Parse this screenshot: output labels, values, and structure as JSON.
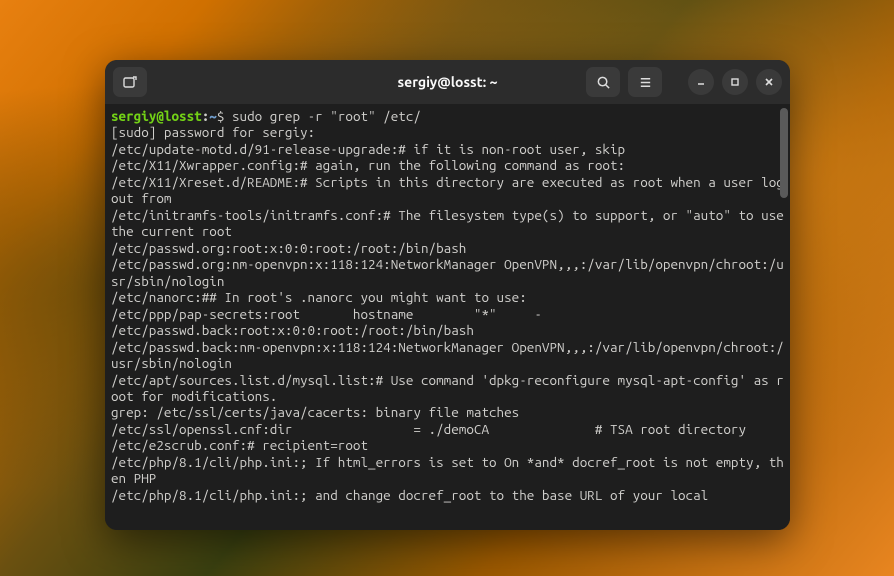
{
  "titlebar": {
    "title": "sergiy@losst: ~"
  },
  "prompt": {
    "user_host": "sergiy@losst",
    "colon": ":",
    "path": "~",
    "symbol": "$",
    "command": "sudo grep -r \"root\" /etc/"
  },
  "lines": [
    "[sudo] password for sergiy:",
    "/etc/update-motd.d/91-release-upgrade:# if it is non-root user, skip",
    "/etc/X11/Xwrapper.config:# again, run the following command as root:",
    "/etc/X11/Xreset.d/README:# Scripts in this directory are executed as root when a user log out from",
    "/etc/initramfs-tools/initramfs.conf:# The filesystem type(s) to support, or \"auto\" to use the current root",
    "/etc/passwd.org:root:x:0:0:root:/root:/bin/bash",
    "/etc/passwd.org:nm-openvpn:x:118:124:NetworkManager OpenVPN,,,:/var/lib/openvpn/chroot:/usr/sbin/nologin",
    "/etc/nanorc:## In root's .nanorc you might want to use:",
    "/etc/ppp/pap-secrets:root       hostname        \"*\"     -",
    "/etc/passwd.back:root:x:0:0:root:/root:/bin/bash",
    "/etc/passwd.back:nm-openvpn:x:118:124:NetworkManager OpenVPN,,,:/var/lib/openvpn/chroot:/usr/sbin/nologin",
    "/etc/apt/sources.list.d/mysql.list:# Use command 'dpkg-reconfigure mysql-apt-config' as root for modifications.",
    "grep: /etc/ssl/certs/java/cacerts: binary file matches",
    "/etc/ssl/openssl.cnf:dir                = ./demoCA              # TSA root directory",
    "/etc/e2scrub.conf:# recipient=root",
    "/etc/php/8.1/cli/php.ini:; If html_errors is set to On *and* docref_root is not empty, then PHP",
    "/etc/php/8.1/cli/php.ini:; and change docref_root to the base URL of your local"
  ]
}
